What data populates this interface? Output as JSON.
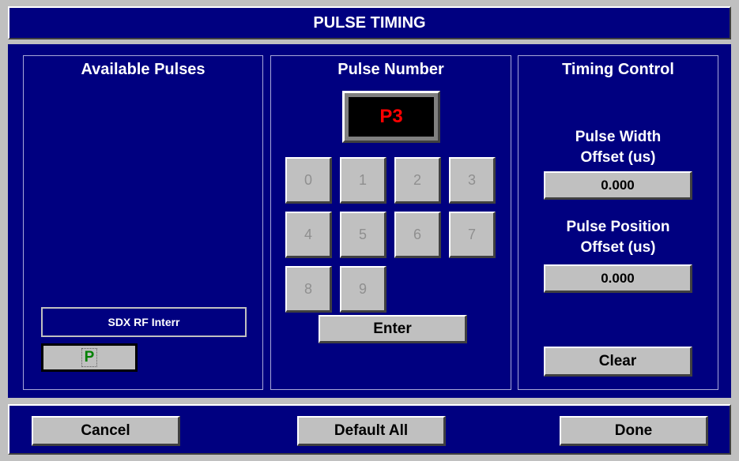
{
  "title": "PULSE TIMING",
  "available_pulses": {
    "heading": "Available Pulses",
    "pulse_name": "SDX RF Interr",
    "pulse_letter": "P"
  },
  "pulse_number": {
    "heading": "Pulse Number",
    "display": "P3",
    "keys": [
      "0",
      "1",
      "2",
      "3",
      "4",
      "5",
      "6",
      "7",
      "8",
      "9"
    ],
    "enter_label": "Enter"
  },
  "timing_control": {
    "heading": "Timing Control",
    "width_label_1": "Pulse Width",
    "width_label_2": "Offset (us)",
    "width_value": "0.000",
    "position_label_1": "Pulse Position",
    "position_label_2": "Offset (us)",
    "position_value": "0.000",
    "clear_label": "Clear"
  },
  "footer": {
    "cancel_label": "Cancel",
    "default_all_label": "Default All",
    "done_label": "Done"
  },
  "colors": {
    "background": "#000080",
    "display_text": "#ff0000",
    "pulse_letter": "#008000"
  }
}
